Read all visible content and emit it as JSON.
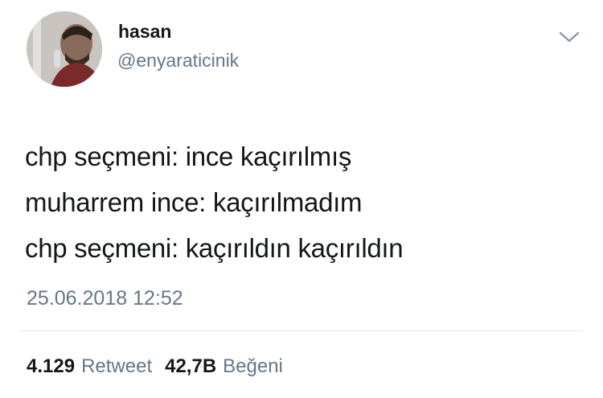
{
  "tweet": {
    "author": {
      "display_name": "hasan",
      "handle": "@enyaraticinik",
      "avatar_icon": "profile-photo"
    },
    "menu_icon": "chevron-down-icon",
    "text_lines": [
      "chp seçmeni: ince kaçırılmış",
      "muharrem ince: kaçırılmadım",
      "chp seçmeni: kaçırıldın kaçırıldın"
    ],
    "timestamp": "25.06.2018 12:52",
    "stats": {
      "retweet_count": "4.129",
      "retweet_label": "Retweet",
      "like_count": "42,7B",
      "like_label": "Beğeni"
    }
  },
  "colors": {
    "text_primary": "#14171a",
    "text_secondary": "#657786",
    "divider": "#e1e8ed",
    "background": "#ffffff"
  }
}
